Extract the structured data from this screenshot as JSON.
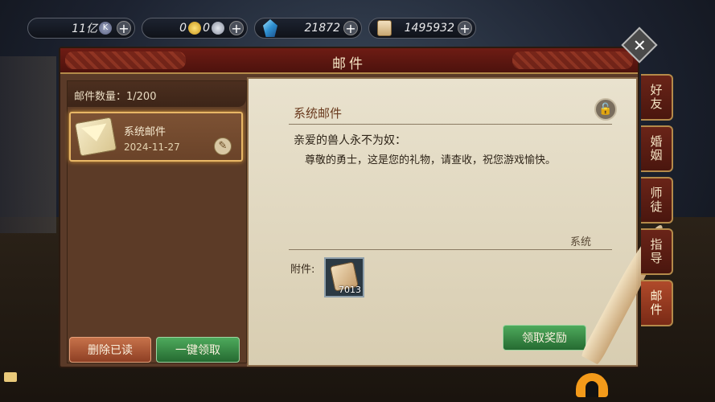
{
  "resources": {
    "coupon": "11亿",
    "coin_gold": "0",
    "coin_silver": "0",
    "diamond": "21872",
    "scroll": "1495932"
  },
  "window": {
    "title": "邮件"
  },
  "left_panel": {
    "count_label": "邮件数量：1/200",
    "mail": {
      "title": "系统邮件",
      "date": "2024-11-27"
    },
    "delete_read_label": "删除已读",
    "claim_all_label": "一键领取"
  },
  "content": {
    "title": "系统邮件",
    "greeting": "亲爱的兽人永不为奴：",
    "body": "尊敬的勇士，这是您的礼物，请查收，祝您游戏愉快。",
    "sender": "系统",
    "attachment_label": "附件:",
    "attachment_count": "7013",
    "claim_label": "领取奖励"
  },
  "tabs": [
    "好友",
    "婚姻",
    "师徒",
    "指导",
    "邮件"
  ],
  "active_tab": "邮件",
  "icons": [
    "k-coin-icon",
    "gold-coin-icon",
    "silver-coin-icon",
    "diamond-icon",
    "scroll-icon",
    "plus-icon",
    "close-icon",
    "envelope-icon",
    "attachment-icon",
    "unlock-icon",
    "quill-icon",
    "folder-icon"
  ],
  "colors": {
    "claim_green": "#3f8f4a",
    "delete_orange": "#b0603a",
    "tab_red": "#6a2418",
    "parchment": "#e3dac3"
  }
}
